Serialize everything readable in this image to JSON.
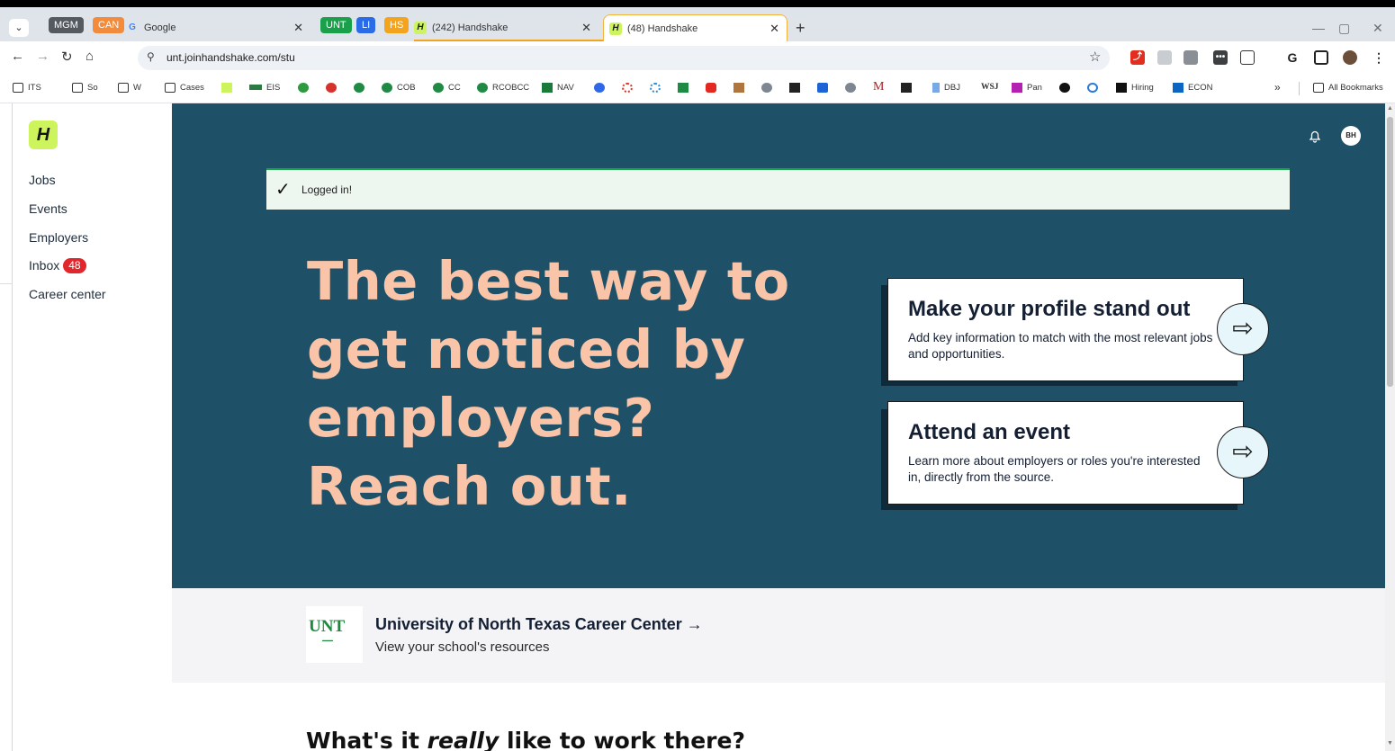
{
  "browser": {
    "tab_groups": [
      {
        "label": "MGM",
        "color": "#555a61"
      },
      {
        "label": "CAN",
        "color": "#f28b3c"
      },
      {
        "label": "UNT",
        "color": "#1a9f4b"
      },
      {
        "label": "LI",
        "color": "#2a6ce8"
      },
      {
        "label": "HS",
        "color": "#f4a41c"
      }
    ],
    "tabs": [
      {
        "title": "Google",
        "icon": "G"
      },
      {
        "title": "(242) Handshake",
        "icon": "H"
      },
      {
        "title": "(48) Handshake",
        "icon": "H"
      }
    ],
    "url": "unt.joinhandshake.com/stu",
    "bookmarks": [
      {
        "label": "ITS",
        "icon": "folder-icon"
      },
      {
        "label": "So",
        "icon": "folder-icon"
      },
      {
        "label": "W",
        "icon": "folder-icon"
      },
      {
        "label": "Cases",
        "icon": "folder-icon"
      },
      {
        "label": "EIS",
        "icon": "unt-icon"
      },
      {
        "label": "COB",
        "icon": "green-icon"
      },
      {
        "label": "CC",
        "icon": "green-icon"
      },
      {
        "label": "RCOBCC",
        "icon": "green-icon"
      },
      {
        "label": "NAV",
        "icon": "unt-icon"
      },
      {
        "label": "DBJ",
        "icon": "arrow-icon"
      },
      {
        "label": "Pan",
        "icon": "p-icon"
      },
      {
        "label": "Hiring",
        "icon": "c-icon"
      },
      {
        "label": "ECON",
        "icon": "linkedin-icon"
      },
      {
        "label": "All Bookmarks",
        "icon": "folder-icon"
      }
    ],
    "bookmark_overflow": "»"
  },
  "sidebar": {
    "logo": "H",
    "items": [
      {
        "label": "Jobs"
      },
      {
        "label": "Events"
      },
      {
        "label": "Employers"
      },
      {
        "label": "Inbox",
        "badge": "48"
      },
      {
        "label": "Career center"
      }
    ]
  },
  "header": {
    "avatar_initials": "BH"
  },
  "toast": {
    "message": "Logged in!"
  },
  "hero": {
    "headline": "The best way to get noticed by employers? Reach out.",
    "cards": [
      {
        "title": "Make your profile stand out",
        "description": "Add key information to match with the most relevant jobs and opportunities."
      },
      {
        "title": "Attend an event",
        "description": "Learn more about employers or roles you're interested in, directly from the source."
      }
    ]
  },
  "school": {
    "logo_text": "UNT",
    "name": "University of North Texas Career Center →",
    "subtitle": "View your school's resources"
  },
  "section": {
    "heading_before": "What's it ",
    "heading_em": "really",
    "heading_after": " like to work there?"
  },
  "colors": {
    "hero_bg": "#1e5167",
    "headline": "#f9c4a8",
    "brand_lime": "#cdf45c",
    "badge_red": "#e3262b",
    "toast_border": "#1aa14a"
  }
}
